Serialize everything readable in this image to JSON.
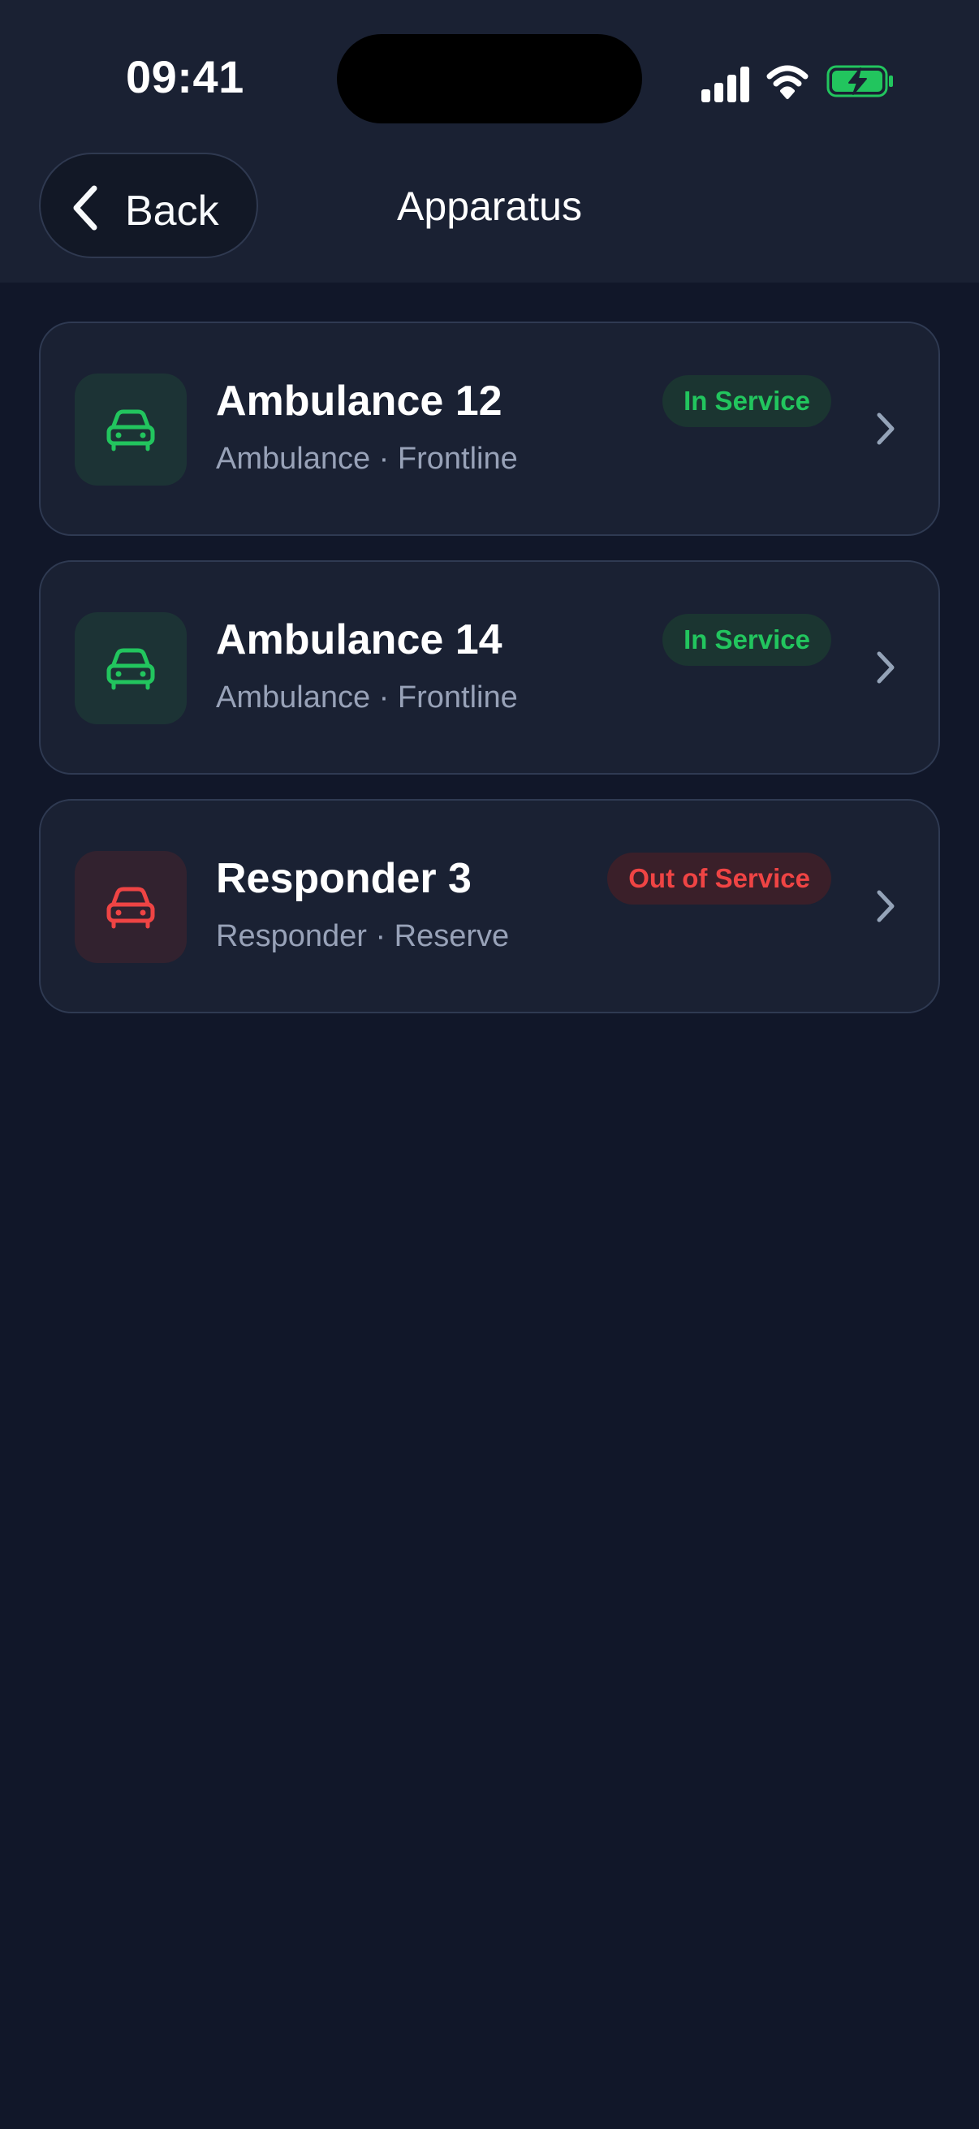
{
  "status_bar": {
    "time": "09:41",
    "icons": [
      "signal-icon",
      "wifi-icon",
      "battery-charging-icon"
    ],
    "battery_color": "#22c55e"
  },
  "nav": {
    "back_label": "Back",
    "title": "Apparatus"
  },
  "apparatus": [
    {
      "name": "Ambulance 12",
      "subtitle": "Ambulance · Frontline",
      "status": "In Service",
      "status_kind": "ok",
      "icon": "car-icon",
      "icon_color": "#22c55e"
    },
    {
      "name": "Ambulance 14",
      "subtitle": "Ambulance · Frontline",
      "status": "In Service",
      "status_kind": "ok",
      "icon": "car-icon",
      "icon_color": "#22c55e"
    },
    {
      "name": "Responder 3",
      "subtitle": "Responder · Reserve",
      "status": "Out of Service",
      "status_kind": "bad",
      "icon": "car-icon",
      "icon_color": "#ef4444"
    }
  ]
}
